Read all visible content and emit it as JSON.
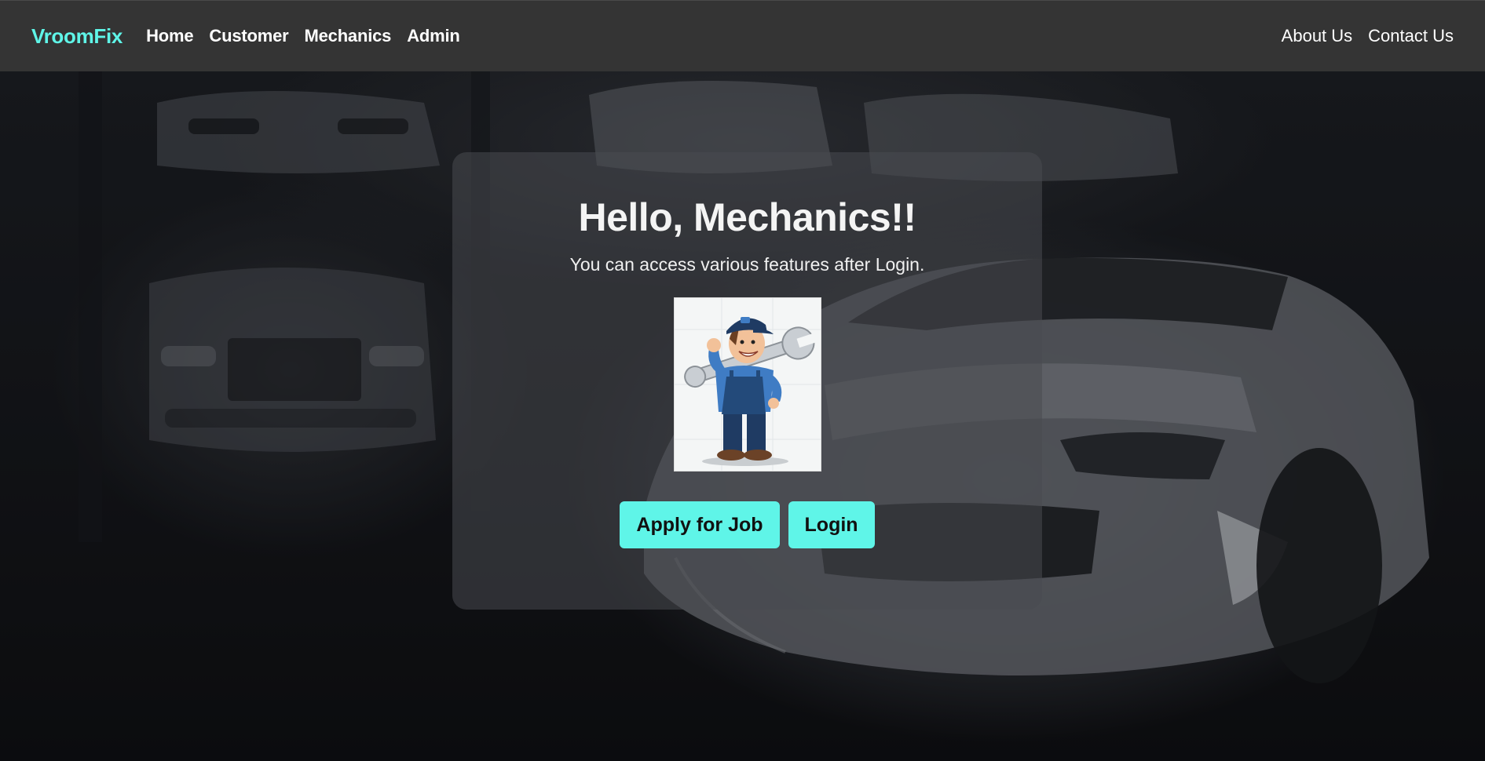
{
  "nav": {
    "brand": "VroomFix",
    "links": [
      "Home",
      "Customer",
      "Mechanics",
      "Admin"
    ],
    "right_links": [
      "About Us",
      "Contact Us"
    ]
  },
  "hero": {
    "title": "Hello, Mechanics!!",
    "subtitle": "You can access various features after Login.",
    "image": "mechanic-with-wrench-cartoon",
    "buttons": {
      "apply": "Apply for Job",
      "login": "Login"
    }
  },
  "colors": {
    "accent": "#5ff5e8",
    "navbar": "#343434",
    "card": "#484a50"
  }
}
